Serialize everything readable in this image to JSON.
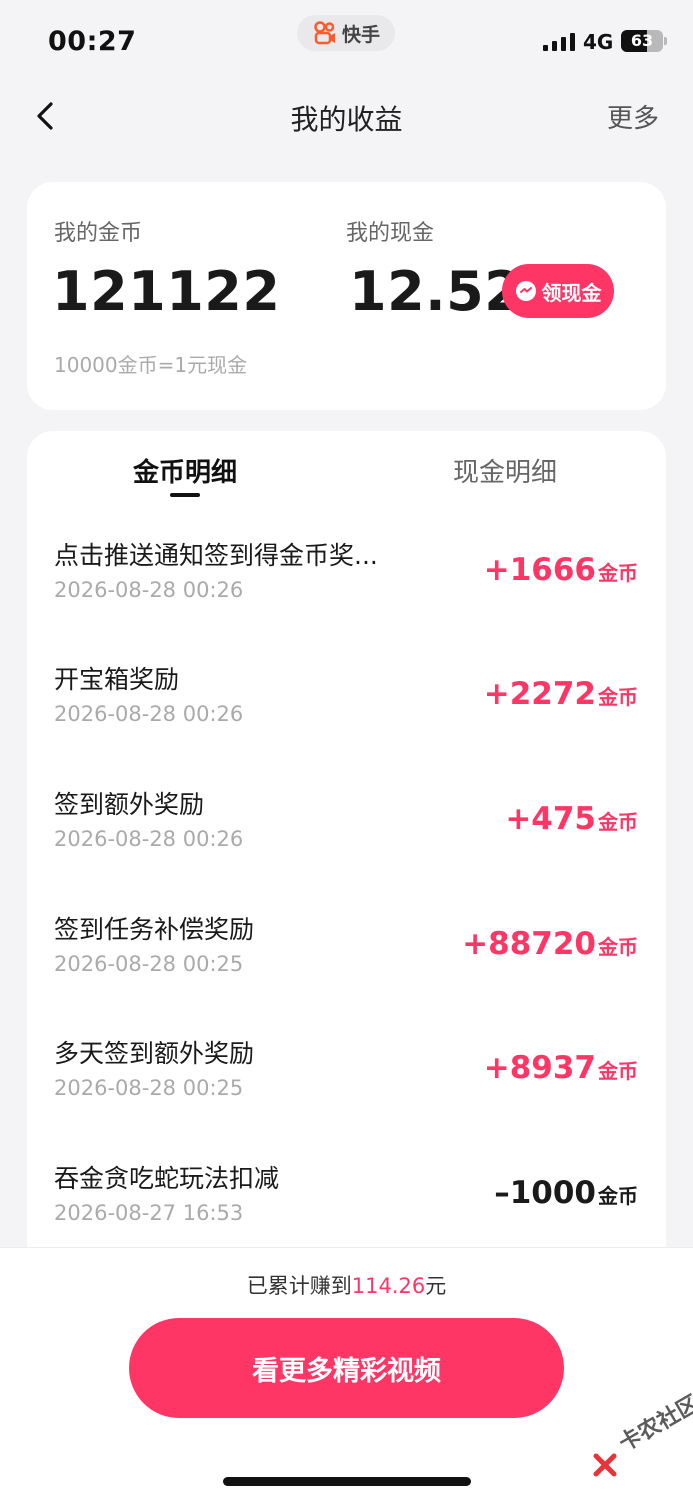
{
  "status_bar": {
    "time": "00:27",
    "app_name": "快手",
    "network": "4G",
    "battery_text": "63",
    "battery_level": 0.63
  },
  "nav": {
    "title": "我的收益",
    "more_label": "更多"
  },
  "balance": {
    "coins_label": "我的金币",
    "coins_value": "121122",
    "cash_label": "我的现金",
    "cash_value": "12.52",
    "withdraw_label": "领现金",
    "rate_text": "10000金币=1元现金"
  },
  "tabs": {
    "coin_detail": "金币明细",
    "cash_detail": "现金明细"
  },
  "records": [
    {
      "title": "点击推送通知签到得金币奖...",
      "date": "2026-08-28 00:26",
      "amount": "+1666",
      "unit": "金币",
      "sign": "pos"
    },
    {
      "title": "开宝箱奖励",
      "date": "2026-08-28 00:26",
      "amount": "+2272",
      "unit": "金币",
      "sign": "pos"
    },
    {
      "title": "签到额外奖励",
      "date": "2026-08-28 00:26",
      "amount": "+475",
      "unit": "金币",
      "sign": "pos"
    },
    {
      "title": "签到任务补偿奖励",
      "date": "2026-08-28 00:25",
      "amount": "+88720",
      "unit": "金币",
      "sign": "pos"
    },
    {
      "title": "多天签到额外奖励",
      "date": "2026-08-28 00:25",
      "amount": "+8937",
      "unit": "金币",
      "sign": "pos"
    },
    {
      "title": "吞金贪吃蛇玩法扣减",
      "date": "2026-08-27 16:53",
      "amount": "–1000",
      "unit": "金币",
      "sign": "neg"
    }
  ],
  "footer": {
    "total_prefix": "已累计赚到",
    "total_value": "114.26",
    "total_suffix": "元",
    "cta_label": "看更多精彩视频"
  },
  "watermark": {
    "text": "卡农社区"
  },
  "colors": {
    "accent": "#fe3666",
    "background": "#f4f4f6"
  }
}
